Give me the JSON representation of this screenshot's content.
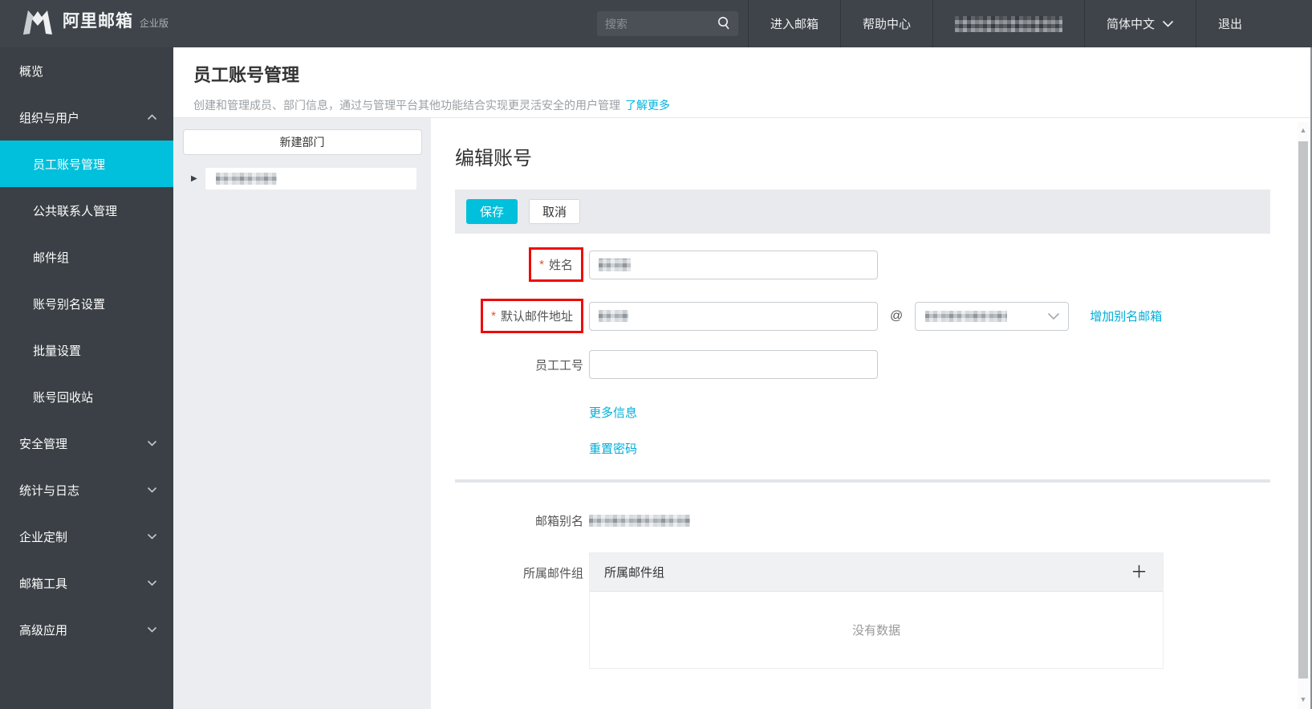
{
  "topbar": {
    "brand": {
      "name": "阿里邮箱",
      "edition": "企业版"
    },
    "search_placeholder": "搜索",
    "enter_mailbox": "进入邮箱",
    "help_center": "帮助中心",
    "account": {
      "masked": true
    },
    "language": "简体中文",
    "logout": "退出"
  },
  "sidebar": {
    "items": [
      {
        "label": "概览",
        "level": "top"
      },
      {
        "label": "组织与用户",
        "level": "top",
        "expanded": true
      },
      {
        "label": "员工账号管理",
        "level": "sub",
        "active": true
      },
      {
        "label": "公共联系人管理",
        "level": "sub"
      },
      {
        "label": "邮件组",
        "level": "sub"
      },
      {
        "label": "账号别名设置",
        "level": "sub"
      },
      {
        "label": "批量设置",
        "level": "sub"
      },
      {
        "label": "账号回收站",
        "level": "sub"
      },
      {
        "label": "安全管理",
        "level": "top",
        "collapsed": true
      },
      {
        "label": "统计与日志",
        "level": "top",
        "collapsed": true
      },
      {
        "label": "企业定制",
        "level": "top",
        "collapsed": true
      },
      {
        "label": "邮箱工具",
        "level": "top",
        "collapsed": true
      },
      {
        "label": "高级应用",
        "level": "top",
        "collapsed": true
      }
    ]
  },
  "page": {
    "title": "员工账号管理",
    "subtitle": "创建和管理成员、部门信息，通过与管理平台其他功能结合实现更灵活安全的用户管理",
    "learn_more": "了解更多"
  },
  "tree": {
    "new_dept_button": "新建部门",
    "root_department": {
      "masked": true
    }
  },
  "editor": {
    "heading": "编辑账号",
    "save": "保存",
    "cancel": "取消",
    "required_mark": "*",
    "fields": {
      "name_label": "姓名",
      "name_value": {
        "masked": true
      },
      "email_label": "默认邮件地址",
      "email_value": {
        "masked": true
      },
      "at": "@",
      "domain_value": {
        "masked": true
      },
      "add_alias_link": "增加别名邮箱",
      "employee_id_label": "员工工号",
      "employee_id_value": "",
      "more_info_link": "更多信息",
      "reset_password_link": "重置密码",
      "alias_label": "邮箱别名",
      "alias_value": {
        "masked": true
      },
      "groups_label": "所属邮件组",
      "groups_panel_title": "所属邮件组",
      "no_data": "没有数据"
    }
  },
  "icons": {
    "search": "magnifier",
    "chevron_up": "∧",
    "chevron_down": "∨",
    "tree_caret": "▶",
    "plus": "＋",
    "scroll_up": "▲",
    "scroll_down": "▼"
  },
  "colors": {
    "topbar_bg": "#3e4449",
    "sidebar_bg": "#3a4045",
    "accent": "#00c0dc",
    "link": "#00aeda",
    "annotation_red": "#ee0a0a",
    "toolbar_bg": "#e8eaed",
    "panel_bg": "#ebedf0"
  }
}
